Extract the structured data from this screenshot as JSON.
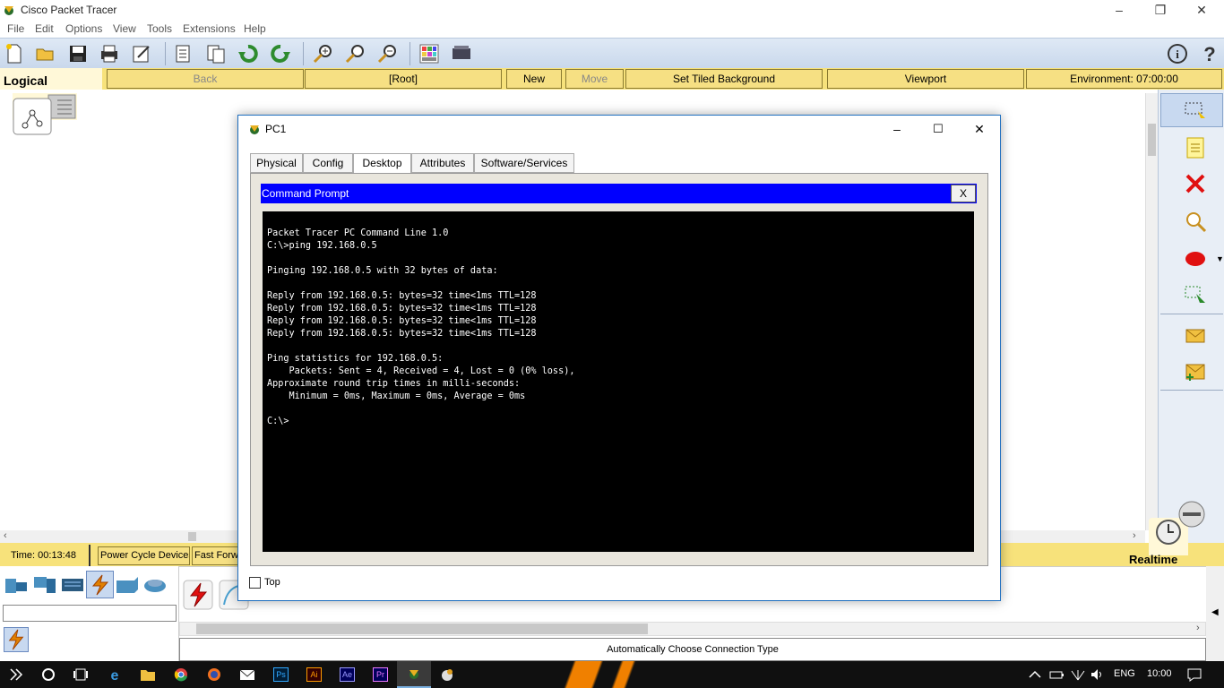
{
  "window": {
    "title": "Cisco Packet Tracer"
  },
  "menu": [
    "File",
    "Edit",
    "Options",
    "View",
    "Tools",
    "Extensions",
    "Help"
  ],
  "navbar": {
    "logical": "Logical",
    "back": "Back",
    "root": "[Root]",
    "new_cluster": "New Cluster",
    "move_object": "Move Object",
    "set_tiled_background": "Set Tiled Background",
    "viewport": "Viewport",
    "environment": "Environment: 07:00:00"
  },
  "status": {
    "time": "Time: 00:13:48",
    "power_cycle": "Power Cycle Devices",
    "fast_forward": "Fast Forwa",
    "mode": "Realtime"
  },
  "bottom": {
    "connection_description": "Automatically Choose Connection Type"
  },
  "pc1": {
    "title": "PC1",
    "tabs": [
      "Physical",
      "Config",
      "Desktop",
      "Attributes",
      "Software/Services"
    ],
    "active_tab": "Desktop",
    "cmd_title": "Command Prompt",
    "cmd_close": "X",
    "terminal_output": "Packet Tracer PC Command Line 1.0\nC:\\>ping 192.168.0.5\n\nPinging 192.168.0.5 with 32 bytes of data:\n\nReply from 192.168.0.5: bytes=32 time<1ms TTL=128\nReply from 192.168.0.5: bytes=32 time<1ms TTL=128\nReply from 192.168.0.5: bytes=32 time<1ms TTL=128\nReply from 192.168.0.5: bytes=32 time<1ms TTL=128\n\nPing statistics for 192.168.0.5:\n    Packets: Sent = 4, Received = 4, Lost = 0 (0% loss),\nApproximate round trip times in milli-seconds:\n    Minimum = 0ms, Maximum = 0ms, Average = 0ms\n\nC:\\>",
    "top_label": "Top"
  },
  "taskbar": {
    "apps": [
      "Ps",
      "Ai",
      "Ae",
      "Pr"
    ],
    "language": "ENG",
    "clock": "10:00"
  }
}
